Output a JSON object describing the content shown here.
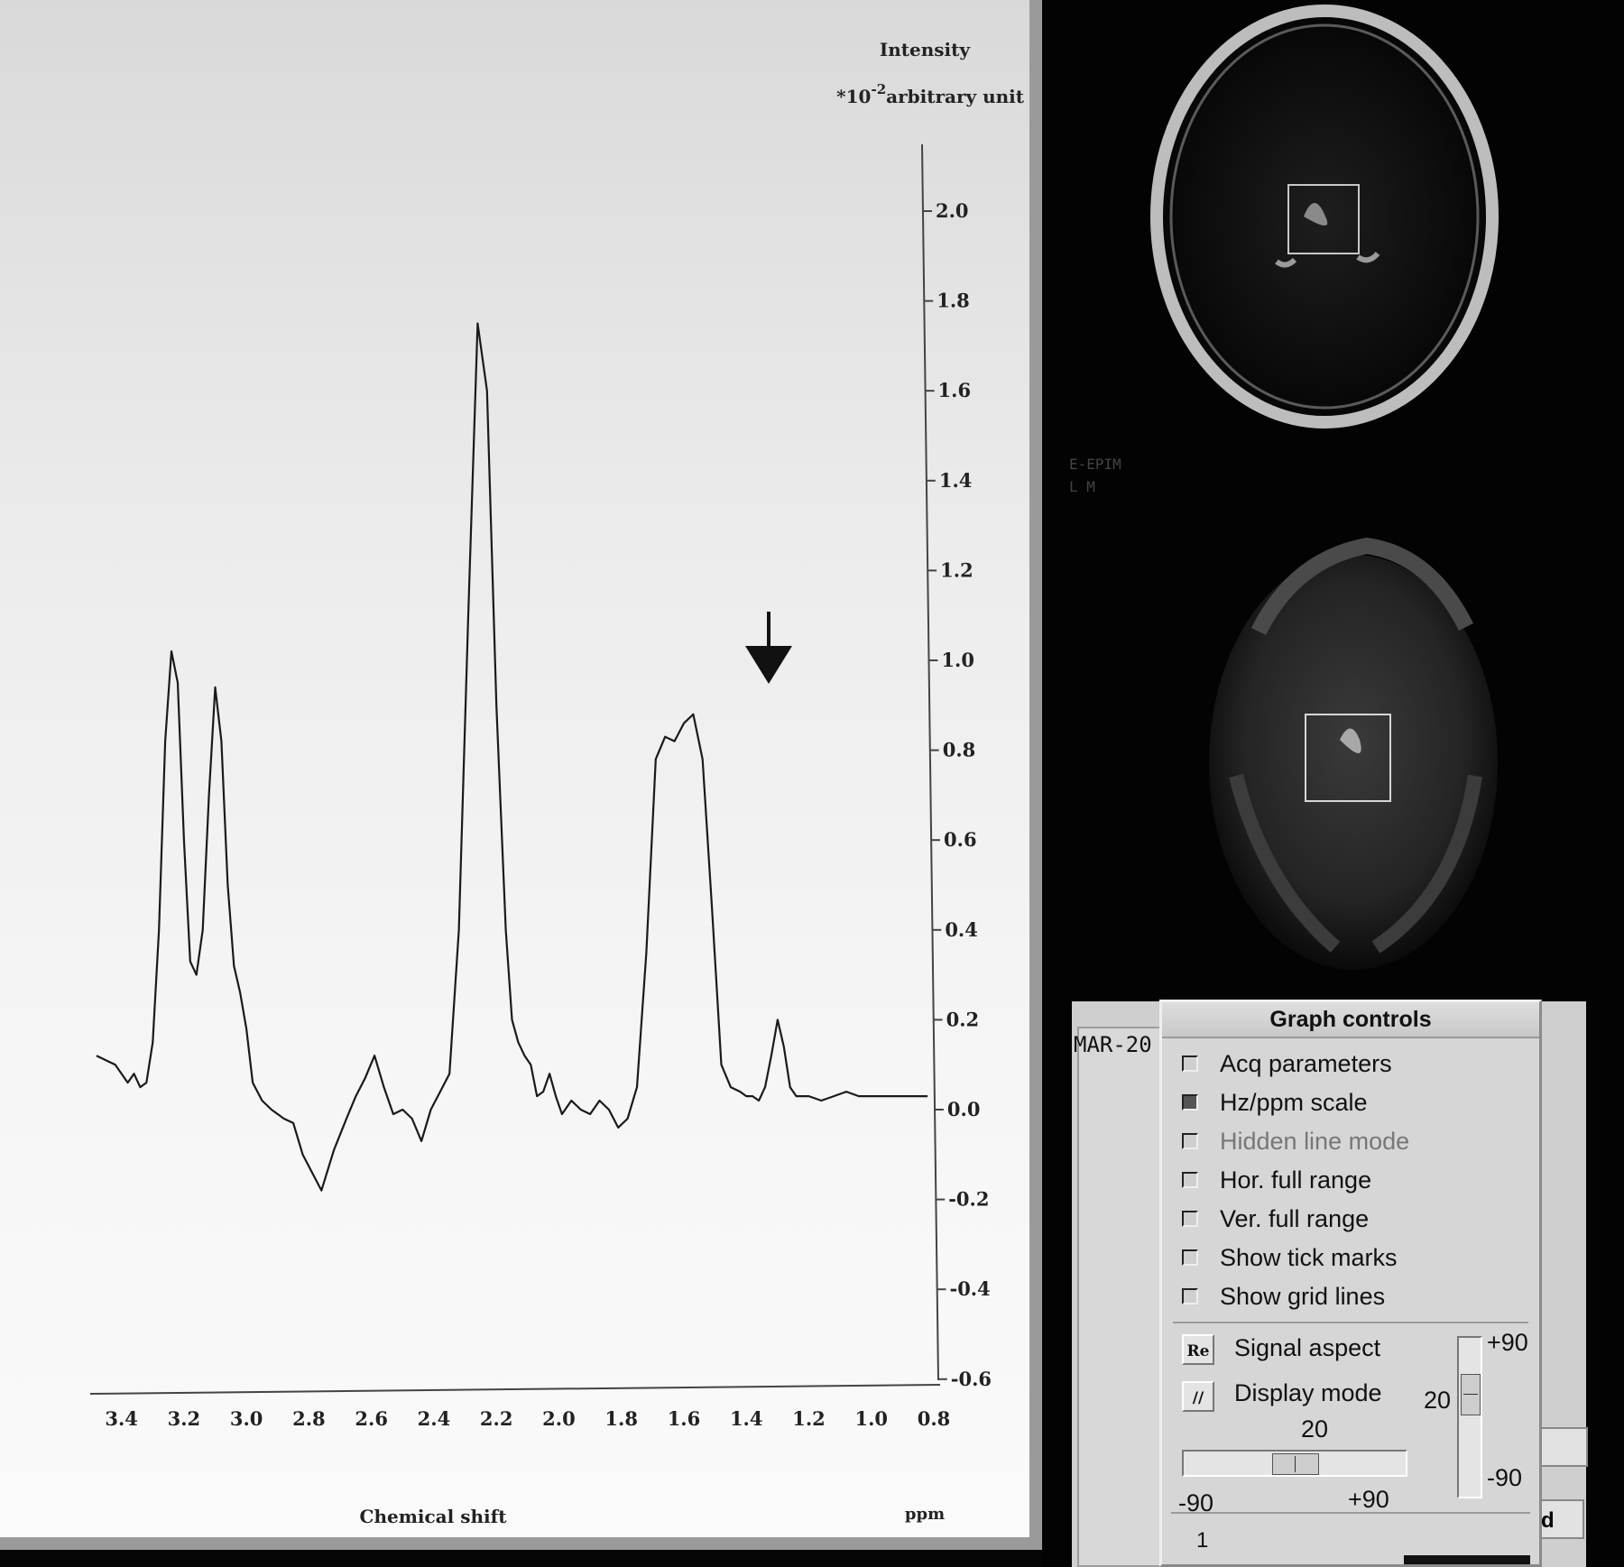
{
  "spectrum": {
    "y_axis": {
      "title": "Intensity",
      "unit_prefix": "*10",
      "unit_exp": "-2",
      "unit_text": "arbitrary unit"
    },
    "x_axis": {
      "title": "Chemical shift",
      "unit": "ppm"
    },
    "y_ticks": [
      "2.0",
      "1.8",
      "1.6",
      "1.4",
      "1.2",
      "1.0",
      "0.8",
      "0.6",
      "0.4",
      "0.2",
      "0.0",
      "-0.2",
      "-0.4",
      "-0.6"
    ],
    "x_ticks": [
      "3.4",
      "3.2",
      "3.0",
      "2.8",
      "2.6",
      "2.4",
      "2.2",
      "2.0",
      "1.8",
      "1.6",
      "1.4",
      "1.2",
      "1.0",
      "0.8"
    ],
    "arrow_icon": "down-arrow",
    "chart_data": {
      "type": "line",
      "xlabel": "Chemical shift",
      "ylabel": "Intensity",
      "xlim": [
        3.5,
        0.8
      ],
      "ylim": [
        -0.6,
        2.1
      ],
      "x": [
        3.48,
        3.42,
        3.38,
        3.36,
        3.34,
        3.32,
        3.3,
        3.28,
        3.26,
        3.24,
        3.22,
        3.2,
        3.18,
        3.16,
        3.14,
        3.12,
        3.1,
        3.08,
        3.06,
        3.04,
        3.02,
        3.0,
        2.98,
        2.95,
        2.92,
        2.88,
        2.85,
        2.82,
        2.79,
        2.76,
        2.72,
        2.68,
        2.65,
        2.62,
        2.59,
        2.56,
        2.53,
        2.5,
        2.47,
        2.44,
        2.41,
        2.38,
        2.35,
        2.32,
        2.29,
        2.26,
        2.23,
        2.2,
        2.17,
        2.15,
        2.13,
        2.11,
        2.09,
        2.07,
        2.05,
        2.03,
        2.01,
        1.99,
        1.96,
        1.93,
        1.9,
        1.87,
        1.84,
        1.81,
        1.78,
        1.75,
        1.72,
        1.69,
        1.66,
        1.63,
        1.6,
        1.57,
        1.54,
        1.51,
        1.48,
        1.45,
        1.42,
        1.4,
        1.38,
        1.36,
        1.34,
        1.32,
        1.3,
        1.28,
        1.26,
        1.24,
        1.22,
        1.2,
        1.16,
        1.12,
        1.08,
        1.04,
        1.0,
        0.97,
        0.94,
        0.91,
        0.88,
        0.85,
        0.82
      ],
      "y": [
        0.12,
        0.1,
        0.06,
        0.08,
        0.05,
        0.06,
        0.15,
        0.4,
        0.82,
        1.02,
        0.95,
        0.6,
        0.33,
        0.3,
        0.4,
        0.7,
        0.94,
        0.82,
        0.5,
        0.32,
        0.26,
        0.18,
        0.06,
        0.02,
        0.0,
        -0.02,
        -0.03,
        -0.1,
        -0.14,
        -0.18,
        -0.09,
        -0.02,
        0.03,
        0.07,
        0.12,
        0.05,
        -0.01,
        0.0,
        -0.02,
        -0.07,
        0.0,
        0.04,
        0.08,
        0.4,
        1.1,
        1.75,
        1.6,
        0.9,
        0.4,
        0.2,
        0.15,
        0.12,
        0.1,
        0.03,
        0.04,
        0.08,
        0.03,
        -0.01,
        0.02,
        0.0,
        -0.01,
        0.02,
        0.0,
        -0.04,
        -0.02,
        0.05,
        0.35,
        0.78,
        0.83,
        0.82,
        0.86,
        0.88,
        0.78,
        0.45,
        0.1,
        0.05,
        0.04,
        0.03,
        0.03,
        0.02,
        0.05,
        0.12,
        0.2,
        0.14,
        0.05,
        0.03,
        0.03,
        0.03,
        0.02,
        0.03,
        0.04,
        0.03,
        0.03,
        0.03,
        0.03,
        0.03,
        0.03,
        0.03,
        0.03
      ]
    }
  },
  "mar_label": "MAR-20",
  "side_button_label": "d",
  "graph_controls": {
    "title": "Graph controls",
    "options": [
      {
        "label": "Acq parameters",
        "state": "unchecked"
      },
      {
        "label": "Hz/ppm scale",
        "state": "checked"
      },
      {
        "label": "Hidden line mode",
        "state": "disabled"
      },
      {
        "label": "Hor. full range",
        "state": "unchecked"
      },
      {
        "label": "Ver. full range",
        "state": "unchecked"
      },
      {
        "label": "Show tick marks",
        "state": "unchecked"
      },
      {
        "label": "Show grid lines",
        "state": "unchecked"
      }
    ],
    "signal_aspect": {
      "button": "Re",
      "label": "Signal aspect"
    },
    "display_mode": {
      "button": "//",
      "label": "Display mode"
    },
    "h_slider": {
      "value": "20",
      "min": "-90",
      "max": "+90",
      "fraction": 0.5
    },
    "v_slider": {
      "value": "20",
      "min": "-90",
      "max": "+90",
      "fraction": 0.3
    },
    "footer_value": "1"
  }
}
